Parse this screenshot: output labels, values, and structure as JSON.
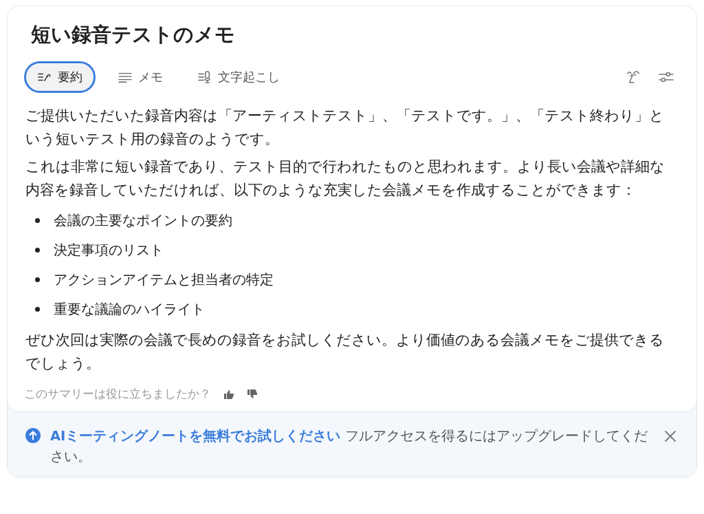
{
  "title": "短い録音テストのメモ",
  "tabs": [
    {
      "label": "要約",
      "kind": "summary",
      "selected": true
    },
    {
      "label": "メモ",
      "kind": "lines",
      "selected": false
    },
    {
      "label": "文字起こし",
      "kind": "mic",
      "selected": false
    }
  ],
  "paragraphs_before": [
    "ご提供いただいた録音内容は「アーティストテスト」、「テストです。」、「テスト終わり」という短いテスト用の録音のようです。",
    "これは非常に短い録音であり、テスト目的で行われたものと思われます。より長い会議や詳細な内容を録音していただければ、以下のような充実した会議メモを作成することができます："
  ],
  "bullets": [
    "会議の主要なポイントの要約",
    "決定事項のリスト",
    "アクションアイテムと担当者の特定",
    "重要な議論のハイライト"
  ],
  "paragraphs_after": [
    "ぜひ次回は実際の会議で長めの録音をお試しください。より価値のある会議メモをご提供できるでしょう。"
  ],
  "feedback": {
    "question": "このサマリーは役に立ちましたか？"
  },
  "banner": {
    "link": "AIミーティングノートを無料でお試しください",
    "text": "フルアクセスを得るにはアップグレードしてください。"
  }
}
